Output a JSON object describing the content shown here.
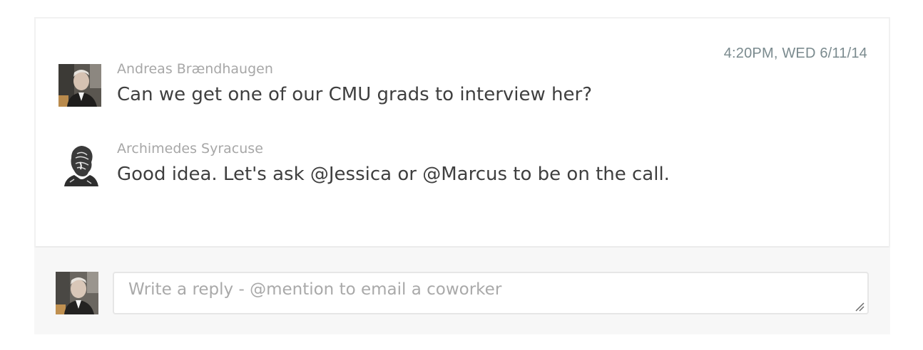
{
  "thread": {
    "timestamp": "4:20PM, WED 6/11/14",
    "messages": [
      {
        "author": "Andreas Brændhaugen",
        "text": "Can we get one of our CMU grads to interview her?",
        "avatar_icon": "person-photo-avatar"
      },
      {
        "author": "Archimedes Syracuse",
        "text": "Good idea. Let's ask @Jessica or @Marcus to be on the call.",
        "avatar_icon": "bust-engraving-avatar"
      }
    ]
  },
  "reply": {
    "placeholder": "Write a reply - @mention to email a coworker",
    "value": "",
    "avatar_icon": "person-photo-avatar"
  },
  "colors": {
    "timestamp": "#7a8a8e",
    "author": "#a7a7a7",
    "message_text": "#3f3f3f",
    "reply_background": "#f7f7f7",
    "placeholder": "#a9a9a9"
  }
}
